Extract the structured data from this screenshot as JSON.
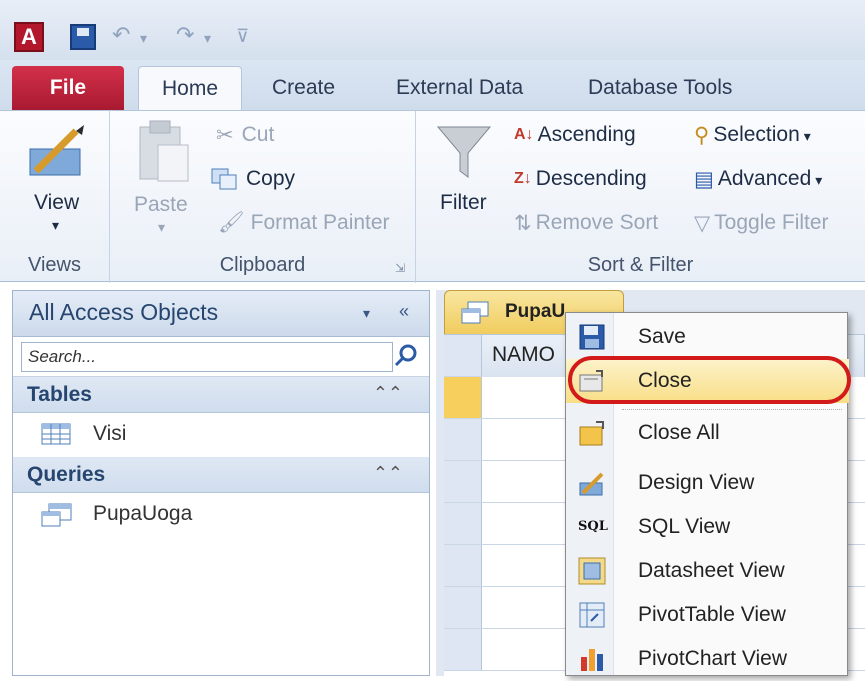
{
  "app": {
    "logo_letter": "A"
  },
  "tabs": [
    {
      "label": "File"
    },
    {
      "label": "Home"
    },
    {
      "label": "Create"
    },
    {
      "label": "External Data"
    },
    {
      "label": "Database Tools"
    }
  ],
  "ribbon": {
    "views": {
      "view_label": "View",
      "group_label": "Views"
    },
    "clipboard": {
      "paste_label": "Paste",
      "cut_label": "Cut",
      "copy_label": "Copy",
      "format_painter_label": "Format Painter",
      "group_label": "Clipboard"
    },
    "sort_filter": {
      "filter_label": "Filter",
      "ascending_label": "Ascending",
      "descending_label": "Descending",
      "remove_sort_label": "Remove Sort",
      "selection_label": "Selection",
      "advanced_label": "Advanced",
      "toggle_filter_label": "Toggle Filter",
      "group_label": "Sort & Filter"
    }
  },
  "nav": {
    "title": "All Access Objects",
    "search_placeholder": "Search...",
    "sections": [
      {
        "title": "Tables",
        "items": [
          {
            "label": "Visi"
          }
        ]
      },
      {
        "title": "Queries",
        "items": [
          {
            "label": "PupaUoga"
          }
        ]
      }
    ]
  },
  "document": {
    "tab_label": "PupaU",
    "column_header": "NAMO"
  },
  "context_menu": {
    "items": [
      {
        "label": "Save",
        "icon": "save-icon"
      },
      {
        "label": "Close",
        "icon": "close-document-icon",
        "highlighted": true
      },
      {
        "label": "Close All",
        "icon": "close-all-icon"
      },
      {
        "label": "Design View",
        "icon": "design-view-icon"
      },
      {
        "label": "SQL View",
        "icon": "sql-icon",
        "icon_text": "SQL"
      },
      {
        "label": "Datasheet View",
        "icon": "datasheet-view-icon"
      },
      {
        "label": "PivotTable View",
        "icon": "pivottable-icon"
      },
      {
        "label": "PivotChart View",
        "icon": "pivotchart-icon"
      }
    ]
  },
  "colors": {
    "file_tab": "#b81d35",
    "highlight_ring": "#d21a1a",
    "menu_hover": "#f8de86"
  }
}
